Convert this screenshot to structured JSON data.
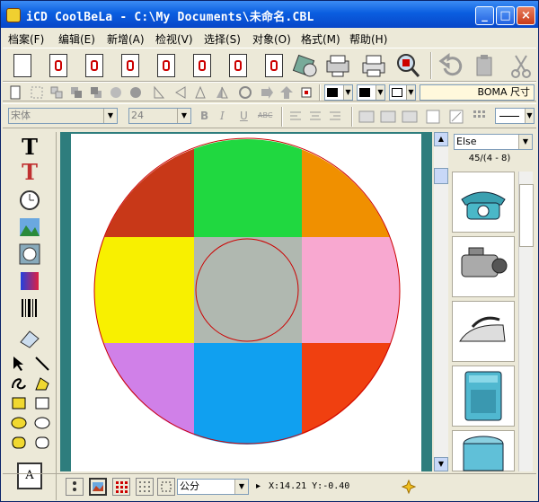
{
  "window": {
    "title": "iCD CoolBeLa - C:\\My Documents\\未命名.CBL",
    "minimize_glyph": "_",
    "maximize_glyph": "□",
    "close_glyph": "×"
  },
  "menu": [
    {
      "label": "档案(F)"
    },
    {
      "label": "编辑(E)"
    },
    {
      "label": "新增(A)"
    },
    {
      "label": "检视(V)"
    },
    {
      "label": "选择(S)"
    },
    {
      "label": "对象(O)"
    },
    {
      "label": "格式(M)"
    },
    {
      "label": "帮助(H)"
    }
  ],
  "toolbar1": {
    "icons": [
      "new-document-icon",
      "label-layout-1-icon",
      "label-layout-2-icon",
      "label-layout-3-icon",
      "label-layout-4-icon",
      "label-layout-5-icon",
      "label-layout-6-icon",
      "label-layout-7-icon",
      "cd-print-icon",
      "disc-printer-icon",
      "printer-icon",
      "magnifier-icon",
      "undo-icon",
      "paste-icon",
      "cut-icon"
    ]
  },
  "toolbar2": {
    "paper_label": "BOMA 尺寸"
  },
  "toolbar3": {
    "font_name": "宋体",
    "font_size": "24",
    "bold": "B",
    "italic": "I",
    "underline": "U",
    "strike": "ABC"
  },
  "clipart": {
    "category": "Else",
    "counter": "45/(4 - 8)",
    "items": [
      "telephone-icon",
      "camcorder-icon",
      "iron-icon",
      "washing-machine-icon",
      "rice-cooker-icon"
    ]
  },
  "status": {
    "unit": "公分",
    "coords": "X:14.21 Y:-0.40"
  },
  "tools": {
    "text_tool": "T",
    "color_text_tool": "T",
    "label_a": "A"
  },
  "colors": {
    "title_blue": "#0a5ee0",
    "canvas_bg": "#2e7d7d",
    "grid": [
      "#c83818",
      "#20d840",
      "#f09000",
      "#f8f000",
      "#b0b8b0",
      "#f8a8d0",
      "#d080e8",
      "#10a0f0",
      "#f04010"
    ]
  }
}
